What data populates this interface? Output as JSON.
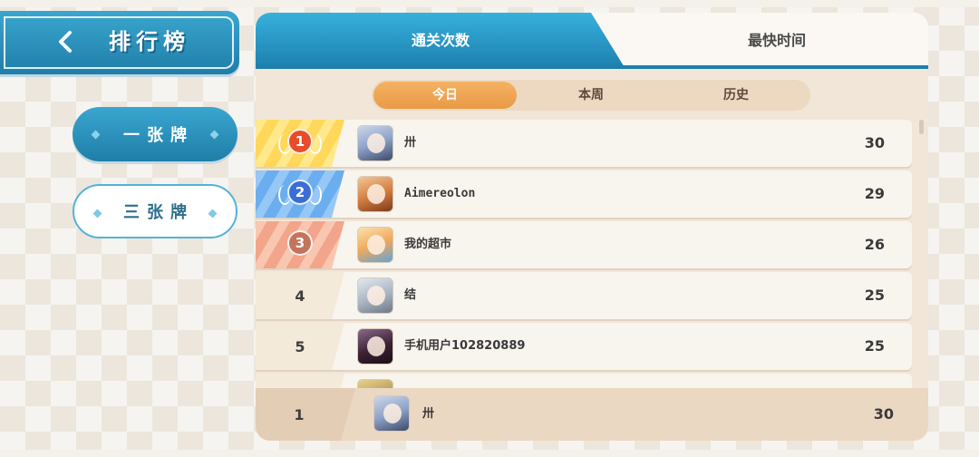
{
  "header": {
    "title": "排行榜",
    "back_icon": "chevron-left-icon"
  },
  "modes": [
    {
      "label": "一张牌",
      "active": true
    },
    {
      "label": "三张牌",
      "active": false
    }
  ],
  "tabs": [
    {
      "label": "通关次数",
      "active": true
    },
    {
      "label": "最快时间",
      "active": false
    }
  ],
  "periods": [
    {
      "label": "今日",
      "active": true
    },
    {
      "label": "本周",
      "active": false
    },
    {
      "label": "历史",
      "active": false
    }
  ],
  "leaderboard": [
    {
      "rank": "1",
      "name": "卅",
      "score": "30",
      "medal": "gold"
    },
    {
      "rank": "2",
      "name": "Aimereolon",
      "score": "29",
      "medal": "silver"
    },
    {
      "rank": "3",
      "name": "我的超市",
      "score": "26",
      "medal": "bronze"
    },
    {
      "rank": "4",
      "name": "结",
      "score": "25"
    },
    {
      "rank": "5",
      "name": "手机用户102820889",
      "score": "25"
    }
  ],
  "my_rank": {
    "rank": "1",
    "name": "卅",
    "score": "30"
  },
  "colors": {
    "primary_blue": "#1f7ea8",
    "accent_orange": "#e99a45",
    "panel_bg": "#f1e6d8",
    "gold": "#ffd75a",
    "silver": "#6aaef0",
    "bronze": "#f2a58a"
  }
}
